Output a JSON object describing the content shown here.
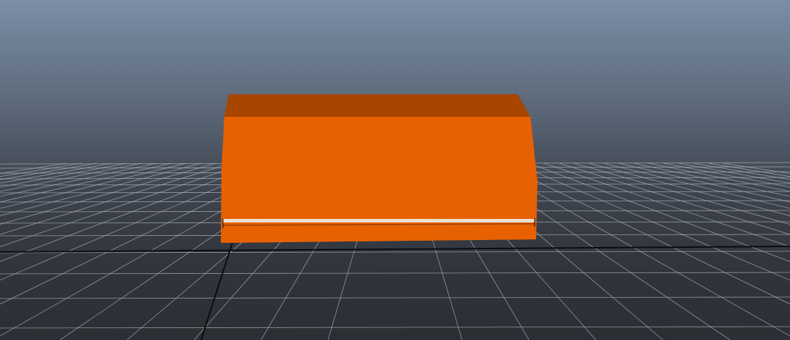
{
  "viewport": {
    "background_top": "#7b8fa6",
    "background_bottom": "#2b2e33",
    "grid_color": "#b7bcc4",
    "axis_color": "#0b0b0c"
  },
  "model": {
    "color_front": "#e86100",
    "color_top": "#a84600",
    "trim_color": "#e9e1d3"
  }
}
